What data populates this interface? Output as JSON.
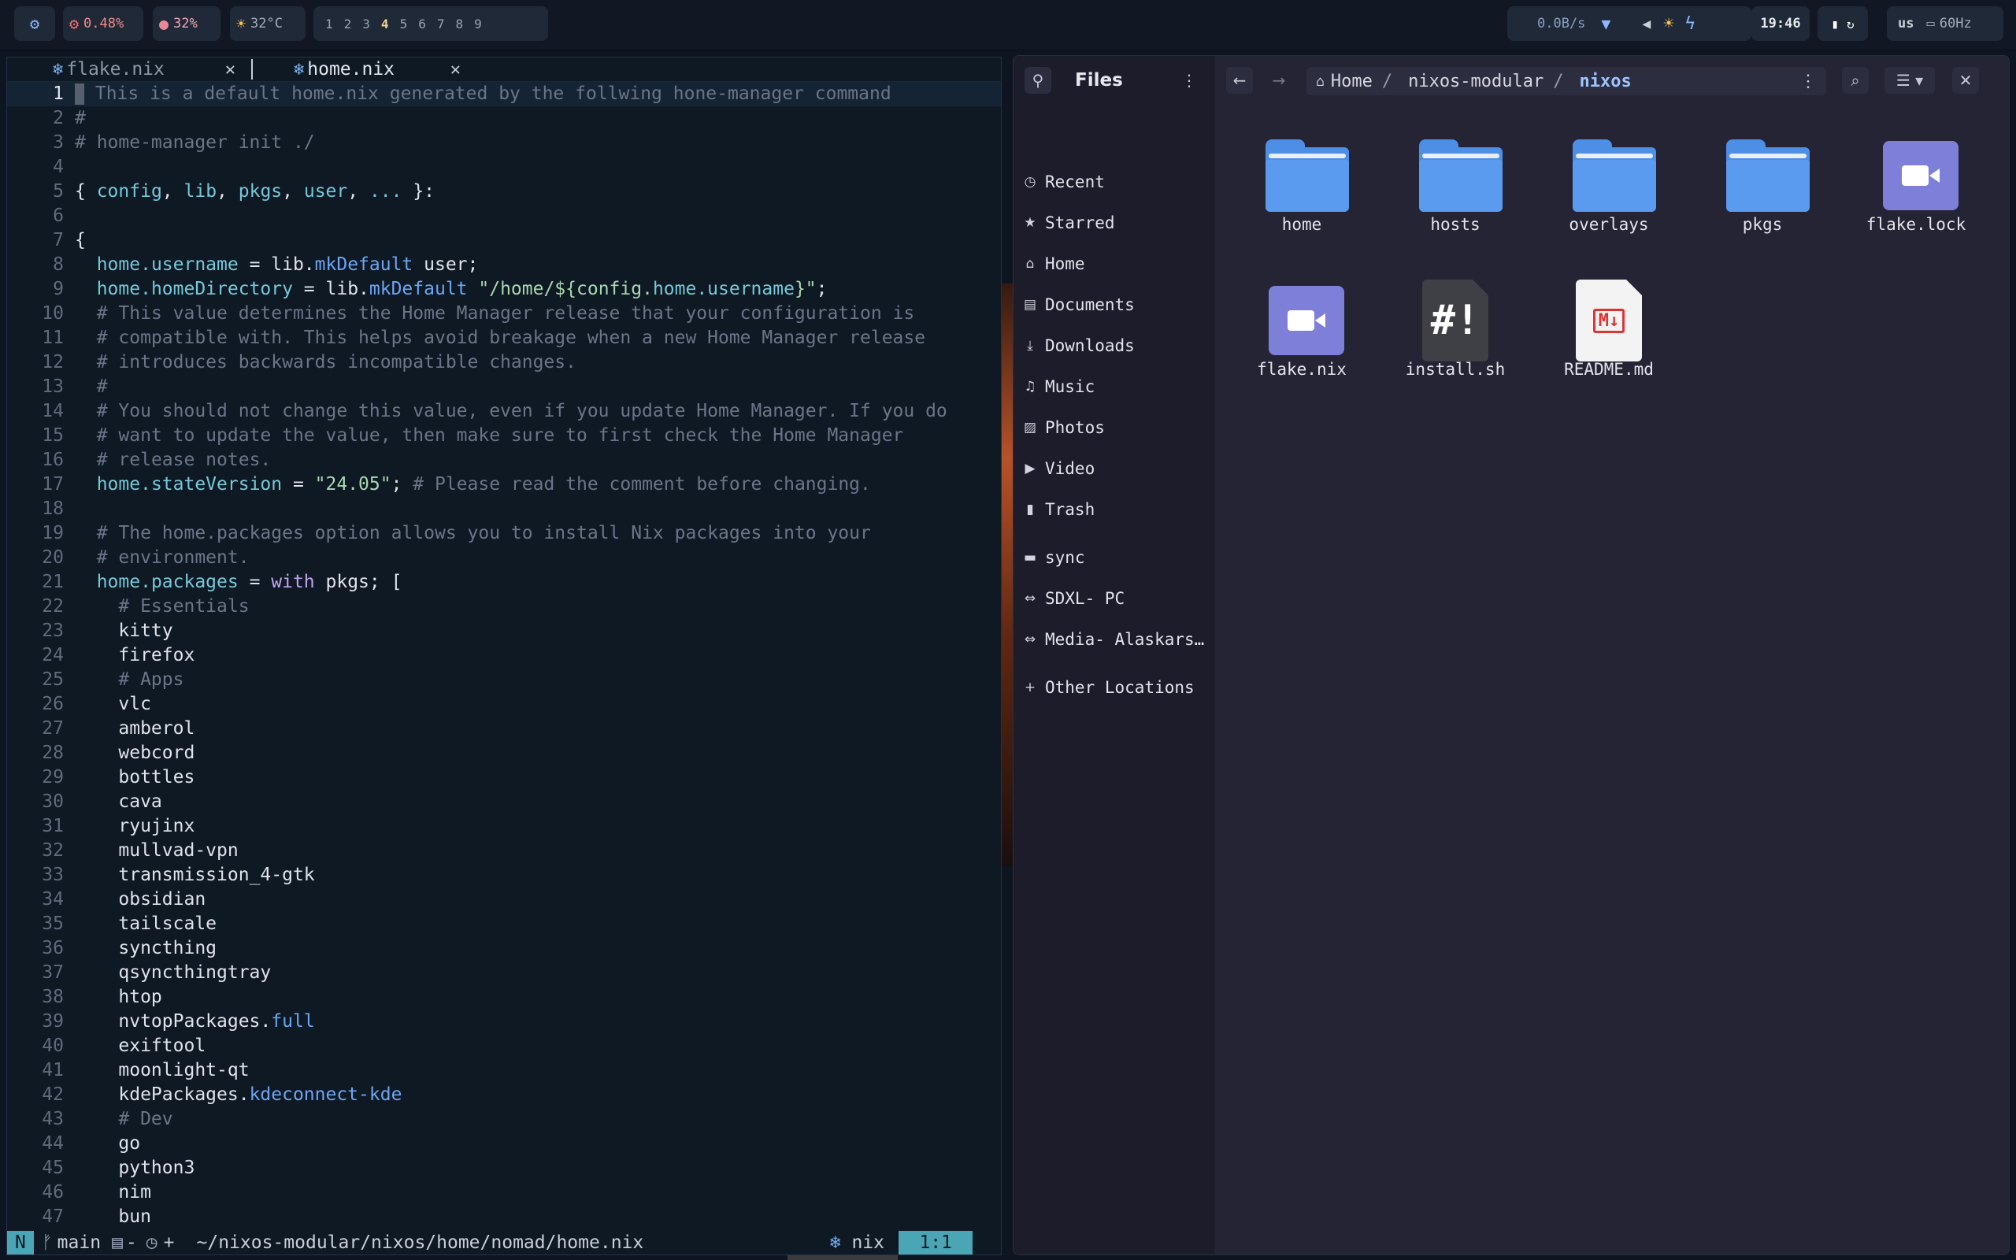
{
  "topbar": {
    "launcher_icon": "gear-icon",
    "cpu": "0.48%",
    "mem": "32%",
    "temp": "32°C",
    "workspaces": [
      "1",
      "2",
      "3",
      "4",
      "5",
      "6",
      "7",
      "8",
      "9"
    ],
    "active_workspace": "4",
    "net": "0.0B/s",
    "clock": "19:46",
    "layout": "us",
    "refresh": "60Hz"
  },
  "editor": {
    "tabs": [
      {
        "name": "flake.nix",
        "active": false
      },
      {
        "name": "home.nix",
        "active": true
      }
    ],
    "lines": [
      "# This is a default home.nix generated by the follwing hone-manager command",
      "#",
      "# home-manager init ./",
      "",
      "{ config, lib, pkgs, user, ... }:",
      "",
      "{",
      "  home.username = lib.mkDefault user;",
      "  home.homeDirectory = lib.mkDefault \"/home/${config.home.username}\";",
      "  # This value determines the Home Manager release that your configuration is",
      "  # compatible with. This helps avoid breakage when a new Home Manager release",
      "  # introduces backwards incompatible changes.",
      "  #",
      "  # You should not change this value, even if you update Home Manager. If you do",
      "  # want to update the value, then make sure to first check the Home Manager",
      "  # release notes.",
      "  home.stateVersion = \"24.05\"; # Please read the comment before changing.",
      "",
      "  # The home.packages option allows you to install Nix packages into your",
      "  # environment.",
      "  home.packages = with pkgs; [",
      "    # Essentials",
      "    kitty",
      "    firefox",
      "    # Apps",
      "    vlc",
      "    amberol",
      "    webcord",
      "    bottles",
      "    cava",
      "    ryujinx",
      "    mullvad-vpn",
      "    transmission_4-gtk",
      "    obsidian",
      "    tailscale",
      "    syncthing",
      "    qsyncthingtray",
      "    htop",
      "    nvtopPackages.full",
      "    exiftool",
      "    moonlight-qt",
      "    kdePackages.kdeconnect-kde",
      "    # Dev",
      "    go",
      "    python3",
      "    nim",
      "    bun"
    ],
    "status": {
      "mode": "N",
      "branch": "main",
      "git_extra": "-",
      "git_extra2": "+",
      "path": "~/nixos-modular/nixos/home/nomad/home.nix",
      "filetype": "nix",
      "position": "1:1"
    }
  },
  "files": {
    "title": "Files",
    "breadcrumb": [
      "Home",
      "nixos-modular",
      "nixos"
    ],
    "sidebar": [
      {
        "label": "Recent",
        "icon": "clock-icon"
      },
      {
        "label": "Starred",
        "icon": "star-icon"
      },
      {
        "label": "Home",
        "icon": "home-icon"
      },
      {
        "label": "Documents",
        "icon": "document-icon"
      },
      {
        "label": "Downloads",
        "icon": "download-icon"
      },
      {
        "label": "Music",
        "icon": "music-icon"
      },
      {
        "label": "Photos",
        "icon": "image-icon"
      },
      {
        "label": "Video",
        "icon": "video-icon"
      },
      {
        "label": "Trash",
        "icon": "trash-icon"
      },
      {
        "label": "sync",
        "icon": "folder-icon"
      },
      {
        "label": "SDXL- PC",
        "icon": "network-icon"
      },
      {
        "label": "Media- Alaskars…",
        "icon": "network-icon"
      },
      {
        "label": "Other Locations",
        "icon": "plus-icon"
      }
    ],
    "items": [
      {
        "name": "home",
        "kind": "folder"
      },
      {
        "name": "hosts",
        "kind": "folder"
      },
      {
        "name": "overlays",
        "kind": "folder"
      },
      {
        "name": "pkgs",
        "kind": "folder"
      },
      {
        "name": "flake.lock",
        "kind": "video"
      },
      {
        "name": "flake.nix",
        "kind": "video"
      },
      {
        "name": "install.sh",
        "kind": "script",
        "glyph": "#!"
      },
      {
        "name": "README.md",
        "kind": "markdown",
        "glyph": "M↓"
      }
    ]
  }
}
